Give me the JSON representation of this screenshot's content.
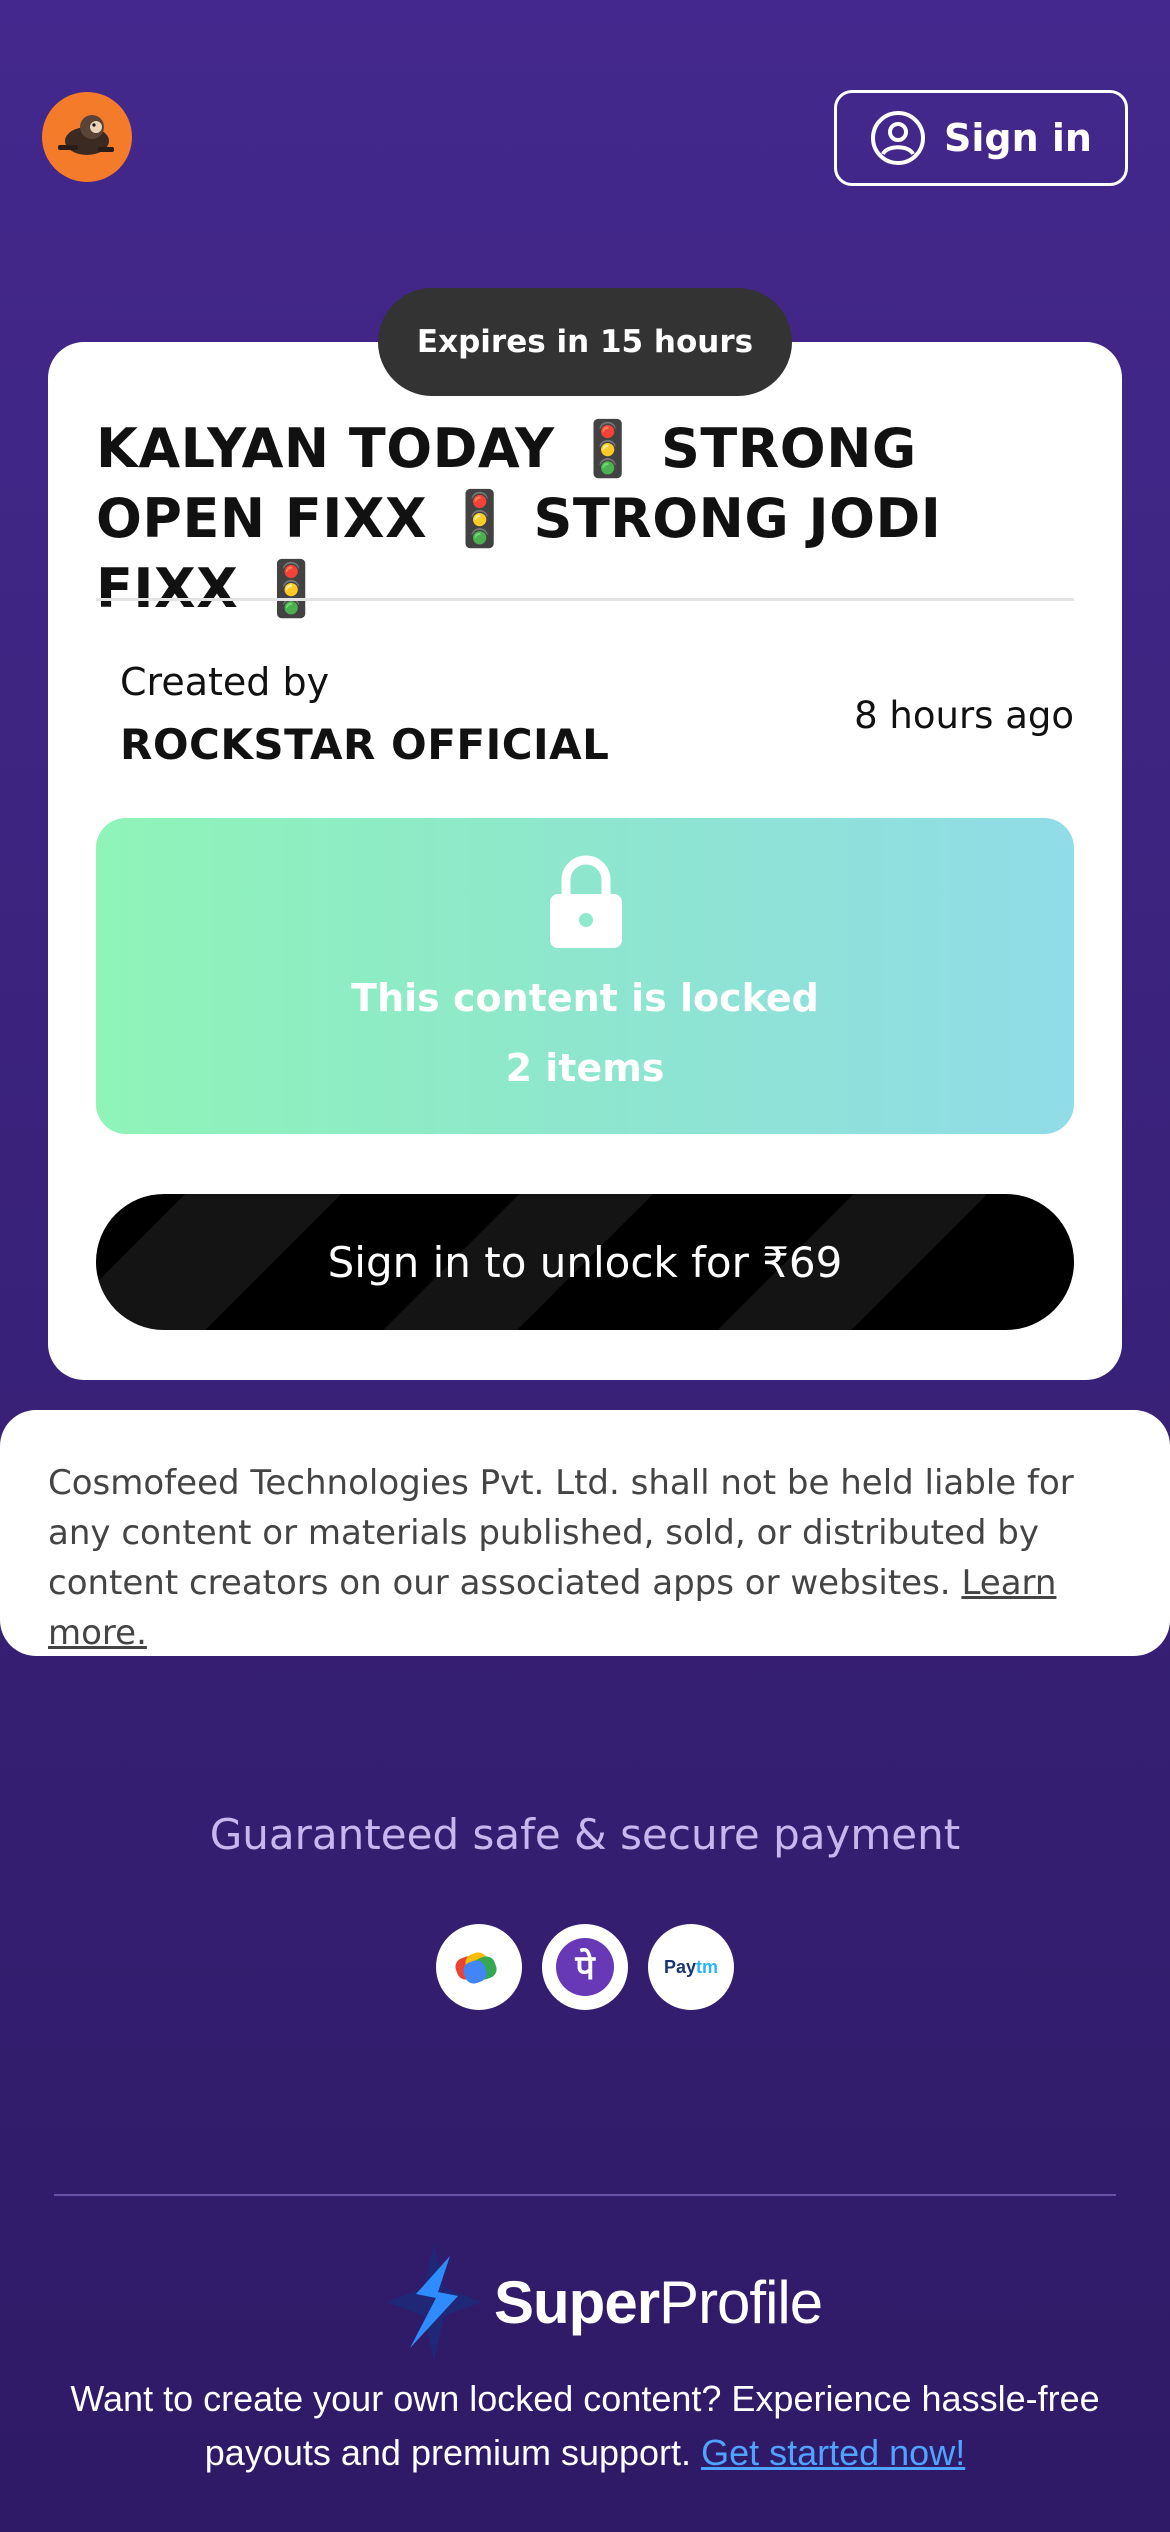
{
  "header": {
    "avatar_icon": "monkey-avatar-icon",
    "signin_label": "Sign in",
    "signin_icon": "user-circle-icon"
  },
  "card": {
    "expires_badge": "Expires in 15 hours",
    "title": "KALYAN TODAY 🚦 STRONG OPEN FIXX 🚦 STRONG JODI FIXX 🚦",
    "created_label": "Created by",
    "creator_name": "ROCKSTAR OFFICIAL",
    "time_ago": "8 hours ago",
    "locked_text": "This content is locked",
    "items_text": "2 items",
    "lock_icon": "lock-icon",
    "unlock_button": "Sign in to unlock for ₹69"
  },
  "disclaimer": {
    "text": "Cosmofeed Technologies Pvt. Ltd. shall not be held liable for any content or materials published, sold, or distributed by content creators on our associated apps or websites.",
    "link": "Learn more."
  },
  "payment": {
    "secure_text": "Guaranteed safe & secure payment",
    "methods": [
      "google-pay-icon",
      "phonepe-icon",
      "paytm-icon"
    ],
    "paytm_text": "Paytm"
  },
  "footer": {
    "brand_bold": "Super",
    "brand_regular": "Profile",
    "text": "Want to create your own locked content? Experience hassle-free payouts and premium support.",
    "link": "Get started now!"
  },
  "colors": {
    "background": "#44288d",
    "card": "#ffffff",
    "locked_gradient_start": "#8ff4b8",
    "locked_gradient_end": "#90dce8",
    "unlock_button": "#000000",
    "link_blue": "#4fa3ff"
  }
}
